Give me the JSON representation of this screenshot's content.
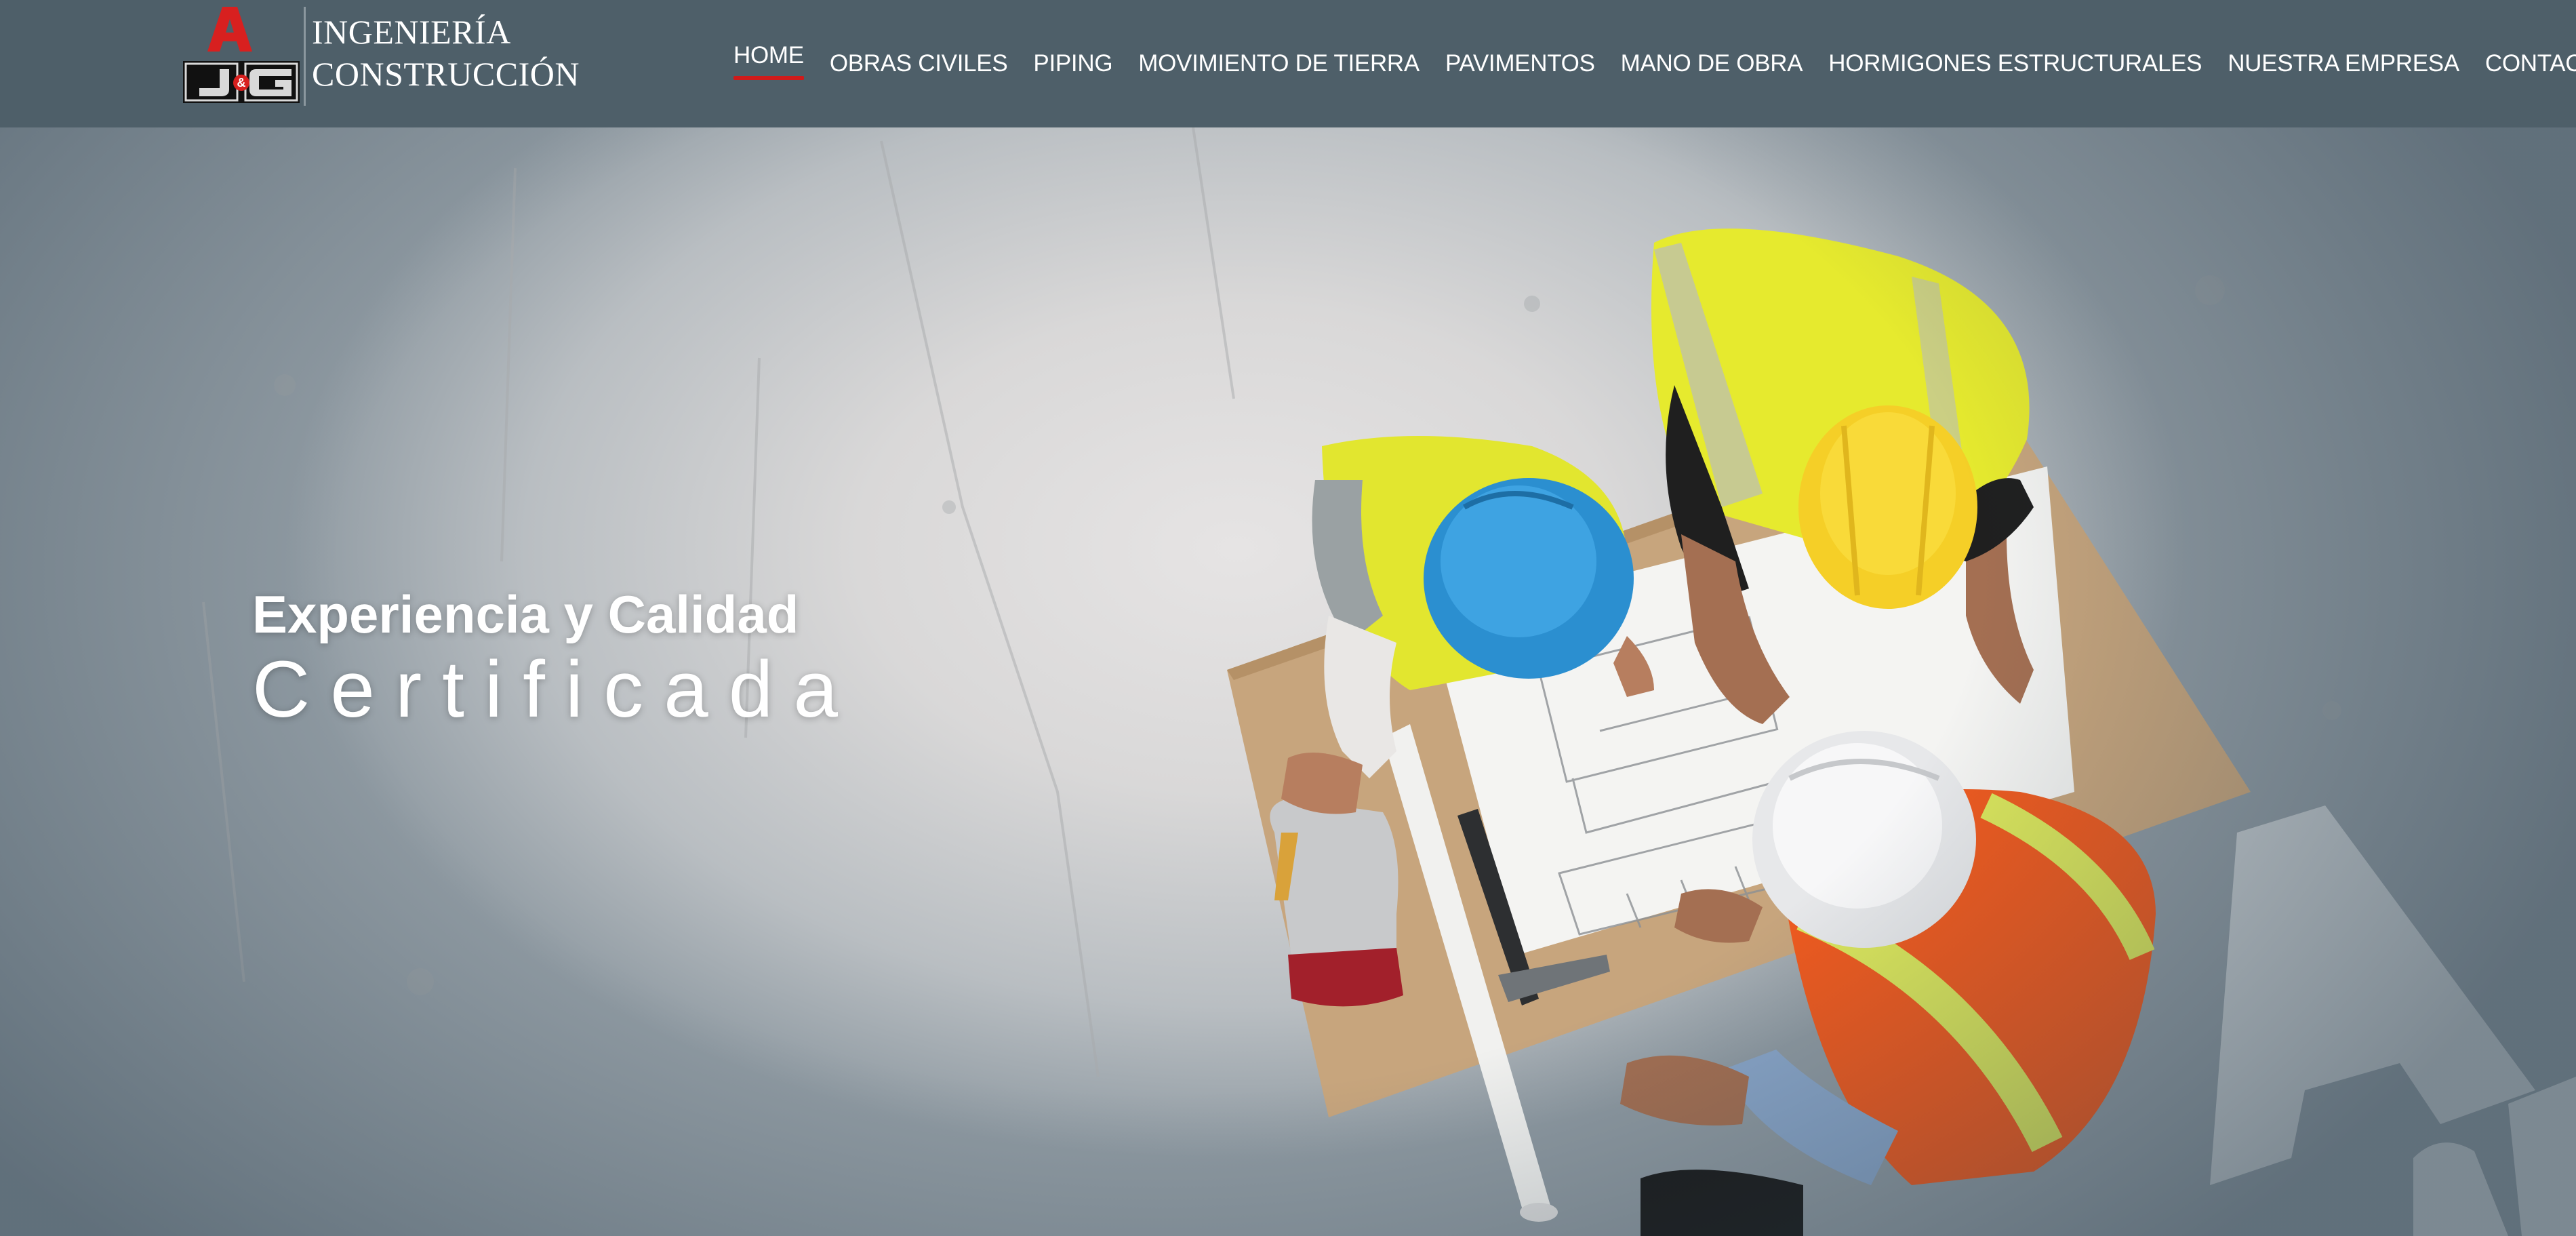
{
  "colors": {
    "header_bg": "#4e5f69",
    "accent_underline": "#d01a1a",
    "nav_text": "#ffffff"
  },
  "logo": {
    "mark_text": "A",
    "mark_subtext": "J&G",
    "line1": "INGENIERÍA",
    "line2": "CONSTRUCCIÓN"
  },
  "nav": {
    "items": [
      {
        "label": "HOME",
        "active": true
      },
      {
        "label": "OBRAS CIVILES",
        "active": false
      },
      {
        "label": "PIPING",
        "active": false
      },
      {
        "label": "MOVIMIENTO DE TIERRA",
        "active": false
      },
      {
        "label": "PAVIMENTOS",
        "active": false
      },
      {
        "label": "MANO DE OBRA",
        "active": false
      },
      {
        "label": "HORMIGONES ESTRUCTURALES",
        "active": false
      },
      {
        "label": "NUESTRA EMPRESA",
        "active": false
      },
      {
        "label": "CONTACTO",
        "active": false
      }
    ]
  },
  "hero": {
    "tagline_line1": "Experiencia y Calidad",
    "tagline_line2": "Certificada",
    "image_description_icons": [
      "worker-yellow-helmet-icon",
      "worker-blue-helmet-icon",
      "worker-white-helmet-icon",
      "blueprint-icon",
      "hammer-icon",
      "gloves-icon"
    ]
  }
}
